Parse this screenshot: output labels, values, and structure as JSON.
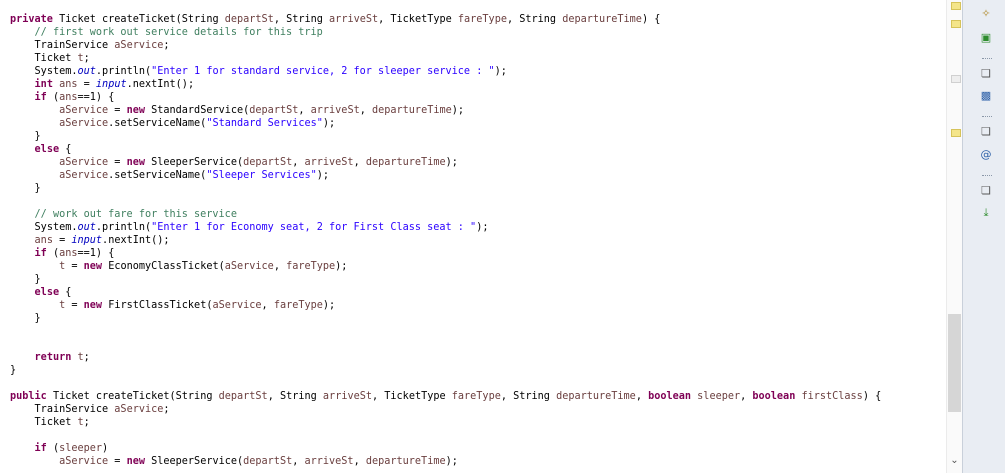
{
  "editor": {
    "lines": [
      [
        [
          "kw",
          "private"
        ],
        [
          "",
          "Ticket createTicket(String "
        ],
        [
          "vr",
          "departSt"
        ],
        [
          "",
          ", String "
        ],
        [
          "vr",
          "arriveSt"
        ],
        [
          "",
          ", TicketType "
        ],
        [
          "vr",
          "fareType"
        ],
        [
          "",
          ", String "
        ],
        [
          "vr",
          "departureTime"
        ],
        [
          "",
          ") {"
        ]
      ],
      [
        [
          "",
          "    "
        ],
        [
          "cm",
          "// first work out service details for this trip"
        ]
      ],
      [
        [
          "",
          "    TrainService "
        ],
        [
          "vr",
          "aService"
        ],
        [
          "",
          ";"
        ]
      ],
      [
        [
          "",
          "    Ticket "
        ],
        [
          "vr",
          "t"
        ],
        [
          "",
          ";"
        ]
      ],
      [
        [
          "",
          "    System."
        ],
        [
          "fd",
          "out"
        ],
        [
          "",
          ".println("
        ],
        [
          "st",
          "\"Enter 1 for standard service, 2 for sleeper service : \""
        ],
        [
          "",
          ");"
        ]
      ],
      [
        [
          "",
          "    "
        ],
        [
          "kw",
          "int"
        ],
        [
          "",
          ""
        ],
        [
          "",
          "  "
        ],
        [
          "vr",
          "ans"
        ],
        [
          "",
          ""
        ],
        [
          "",
          ""
        ],
        [
          "",
          ""
        ],
        [
          "",
          ""
        ],
        [
          "",
          ""
        ]
      ],
      [
        [
          "",
          "    "
        ],
        [
          "kw",
          "if"
        ],
        [
          "",
          ""
        ],
        [
          "",
          ""
        ],
        [
          "",
          ""
        ],
        [
          "",
          ""
        ],
        [
          "",
          ""
        ],
        [
          "",
          ""
        ],
        [
          "",
          ""
        ],
        [
          "",
          ""
        ]
      ],
      [
        [
          "",
          "        "
        ],
        [
          "vr",
          "aService"
        ],
        [
          "",
          ""
        ],
        [
          "",
          ""
        ],
        [
          "",
          ""
        ],
        [
          "",
          ""
        ],
        [
          "",
          ""
        ],
        [
          "",
          ""
        ],
        [
          "",
          ""
        ],
        [
          "",
          ""
        ]
      ],
      [
        [
          "",
          "        "
        ],
        [
          "vr",
          "aService"
        ],
        [
          "",
          ".setServiceName("
        ],
        [
          "st",
          "\"Standard Services\""
        ],
        [
          "",
          ");"
        ]
      ],
      [
        [
          "",
          "    }"
        ]
      ],
      [
        [
          "",
          "    "
        ],
        [
          "kw",
          "else"
        ],
        [
          "",
          ""
        ],
        [
          "",
          ""
        ]
      ],
      [
        [
          "",
          "        "
        ],
        [
          "vr",
          "aService"
        ],
        [
          "",
          ""
        ],
        [
          "",
          ""
        ],
        [
          "",
          ""
        ],
        [
          "",
          ""
        ],
        [
          "",
          ""
        ],
        [
          "",
          ""
        ],
        [
          "",
          ""
        ],
        [
          "",
          ""
        ]
      ],
      [
        [
          "",
          "        "
        ],
        [
          "vr",
          "aService"
        ],
        [
          "",
          ".setServiceName("
        ],
        [
          "st",
          "\"Sleeper Services\""
        ],
        [
          "",
          ");"
        ]
      ],
      [
        [
          "",
          "    }"
        ]
      ],
      [
        [
          "",
          ""
        ]
      ],
      [
        [
          "",
          "    "
        ],
        [
          "cm",
          "// work out fare for this service"
        ]
      ],
      [
        [
          "",
          "    System."
        ],
        [
          "fd",
          "out"
        ],
        [
          "",
          ".println("
        ],
        [
          "st",
          "\"Enter 1 for Economy seat, 2 for First Class seat : \""
        ],
        [
          "",
          ");"
        ]
      ],
      [
        [
          "",
          "    "
        ],
        [
          "vr",
          "ans"
        ],
        [
          "",
          ""
        ],
        [
          "",
          ""
        ],
        [
          "",
          ""
        ],
        [
          "",
          ""
        ]
      ],
      [
        [
          "",
          "    "
        ],
        [
          "kw",
          "if"
        ],
        [
          "",
          ""
        ],
        [
          "",
          ""
        ],
        [
          "",
          ""
        ],
        [
          "",
          ""
        ]
      ],
      [
        [
          "",
          "        "
        ],
        [
          "vr",
          "t"
        ],
        [
          "",
          ""
        ],
        [
          "",
          ""
        ],
        [
          "",
          ""
        ],
        [
          "",
          ""
        ],
        [
          "",
          ""
        ],
        [
          "",
          ""
        ],
        [
          "",
          ""
        ]
      ],
      [
        [
          "",
          "    }"
        ]
      ],
      [
        [
          "",
          "    "
        ],
        [
          "kw",
          "else"
        ],
        [
          "",
          ""
        ],
        [
          "",
          ""
        ]
      ],
      [
        [
          "",
          "        "
        ],
        [
          "vr",
          "t"
        ],
        [
          "",
          ""
        ],
        [
          "",
          ""
        ],
        [
          "",
          ""
        ],
        [
          "",
          ""
        ],
        [
          "",
          ""
        ],
        [
          "",
          ""
        ],
        [
          "",
          ""
        ]
      ],
      [
        [
          "",
          "    }"
        ]
      ],
      [
        [
          "",
          ""
        ]
      ],
      [
        [
          "",
          ""
        ]
      ],
      [
        [
          "",
          "    "
        ],
        [
          "kw",
          "return"
        ],
        [
          "",
          ""
        ],
        [
          "vr",
          "t"
        ],
        [
          "",
          ";"
        ]
      ],
      [
        [
          "",
          "}"
        ]
      ],
      [
        [
          "",
          ""
        ]
      ],
      [
        [
          "kw",
          "public"
        ],
        [
          "",
          "Ticket createTicket(String "
        ],
        [
          "vr",
          "departSt"
        ],
        [
          "",
          ", String "
        ],
        [
          "vr",
          "arriveSt"
        ],
        [
          "",
          ", TicketType "
        ],
        [
          "vr",
          "fareType"
        ],
        [
          "",
          ", String "
        ],
        [
          "vr",
          "departureTime"
        ],
        [
          "",
          ", "
        ],
        [
          "kw",
          "boolean"
        ],
        [
          "",
          ""
        ],
        [
          "vr",
          "sleeper"
        ],
        [
          "",
          ", "
        ],
        [
          "kw",
          "boolean"
        ],
        [
          "",
          ""
        ],
        [
          "vr",
          "firstClass"
        ],
        [
          "",
          ") {"
        ]
      ],
      [
        [
          "",
          "    TrainService "
        ],
        [
          "vr",
          "aService"
        ],
        [
          "",
          ";"
        ]
      ],
      [
        [
          "",
          "    Ticket "
        ],
        [
          "vr",
          "t"
        ],
        [
          "",
          ";"
        ]
      ],
      [
        [
          "",
          ""
        ]
      ],
      [
        [
          "",
          "    "
        ],
        [
          "kw",
          "if"
        ],
        [
          "",
          ""
        ],
        [
          "vr",
          "sleeper"
        ],
        [
          "",
          ")"
        ]
      ],
      [
        [
          "",
          "        "
        ],
        [
          "vr",
          "aService"
        ],
        [
          "",
          ""
        ],
        [
          "",
          ""
        ],
        [
          "",
          ""
        ],
        [
          "",
          ""
        ],
        [
          "",
          ""
        ],
        [
          "",
          ""
        ],
        [
          "",
          ""
        ],
        [
          "",
          ""
        ]
      ]
    ]
  },
  "sidebar": {
    "icons": [
      "wrench-icon",
      "new-class-icon",
      "restore-icon",
      "console-icon",
      "restore-icon",
      "javadoc-icon",
      "restore-icon",
      "declaration-icon"
    ]
  }
}
